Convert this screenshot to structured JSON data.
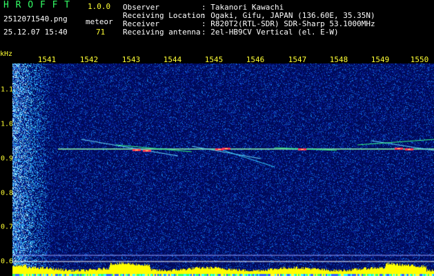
{
  "app": {
    "name": "H R O F F T",
    "version": "1.0.0",
    "filename": "2512071540.png",
    "datetime": "25.12.07 15:40",
    "meteor_label": "meteor",
    "meteor_count": "71"
  },
  "info": {
    "rows": [
      {
        "label": "Observer",
        "value": ": Takanori Kawachi"
      },
      {
        "label": "Receiving Location",
        "value": ": Ogaki, Gifu, JAPAN (136.60E, 35.35N)"
      },
      {
        "label": "Receiver",
        "value": ": R820T2(RTL-SDR) SDR-Sharp 53.1000MHz"
      },
      {
        "label": "Receiving antenna",
        "value": ": 2el-HB9CV Vertical (el. E-W)"
      }
    ]
  },
  "axes": {
    "y_unit": "kHz",
    "x_ticks": [
      "1541",
      "1542",
      "1543",
      "1544",
      "1545",
      "1546",
      "1547",
      "1548",
      "1549",
      "1550"
    ],
    "y_ticks": [
      "1.1",
      "1.0",
      "0.9",
      "0.8",
      "0.7",
      "0.6"
    ]
  },
  "colors": {
    "background": "#000000",
    "noise": "#0a1a8a",
    "trace": "#ffff33",
    "label": "#ffff33"
  }
}
